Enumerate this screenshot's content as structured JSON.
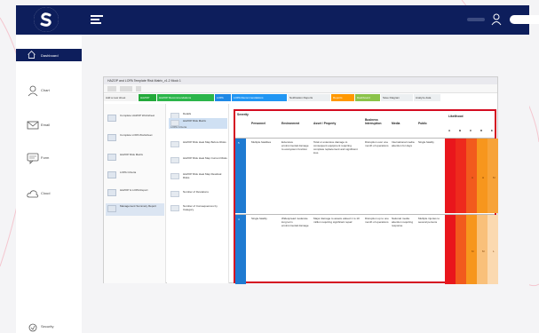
{
  "nav": {
    "items": [
      {
        "label": "Dashboard",
        "icon": "home-icon"
      },
      {
        "label": "Chart",
        "icon": "user-icon"
      },
      {
        "label": "Email",
        "icon": "mail-icon"
      },
      {
        "label": "Form",
        "icon": "chat-icon"
      },
      {
        "label": "Cloud",
        "icon": "cloud-icon"
      },
      {
        "label": "Security",
        "icon": "lock-icon"
      }
    ]
  },
  "shot": {
    "title": "HAZOP and LOPA Template Risk Matrix_v1.2 Mock 1",
    "ribbon": [
      {
        "label": "Add a new sheet",
        "color": "#f3f3f3",
        "text": "#333"
      },
      {
        "label": "HAZOP",
        "color": "#23a93a",
        "text": "#fff"
      },
      {
        "label": "HAZOP Recommendations",
        "color": "#2bb54a",
        "text": "#fff"
      },
      {
        "label": "LOPA",
        "color": "#1e88e5",
        "text": "#fff"
      },
      {
        "label": "LOPA Recommendations",
        "color": "#2196f3",
        "text": "#fff"
      },
      {
        "label": "Notification Reports",
        "color": "#eceff1",
        "text": "#333"
      },
      {
        "label": "Reports",
        "color": "#ff9800",
        "text": "#fff"
      },
      {
        "label": "Dashboard",
        "color": "#8bc34a",
        "text": "#fff"
      },
      {
        "label": "Save Diagram",
        "color": "#eceff1",
        "text": "#333"
      },
      {
        "label": "Analyze data",
        "color": "#eceff1",
        "text": "#333"
      }
    ],
    "files": [
      {
        "label": "Complete HAZOP Worksheet"
      },
      {
        "label": "Complete LOPA Worksheet"
      },
      {
        "label": "HAZOP Risk Matrix"
      },
      {
        "label": "LOPA Criteria"
      },
      {
        "label": "HAZOP & LOPA Report"
      },
      {
        "label": "Management Summary Report"
      }
    ],
    "items_header": "LOPA Criteria",
    "items": [
      {
        "label": "Details"
      },
      {
        "label": "HAZOP Risk Matrix"
      },
      {
        "label": "HAZOP Risk Heat Map Before Risks"
      },
      {
        "label": "HAZOP Risk Heat Map Current Risks"
      },
      {
        "label": "HAZOP Risk Heat Map Residual Risks"
      },
      {
        "label": "Number of Deviations"
      },
      {
        "label": "Number of Consequences by Category"
      }
    ],
    "grid": {
      "headers": [
        "Severity",
        "Personnel",
        "Environment",
        "Asset / Property",
        "Business Interruption",
        "Media",
        "Public",
        "Likelihood"
      ],
      "likelihood_levels": [
        "A",
        "B",
        "C",
        "D",
        "E"
      ],
      "rows": [
        {
          "sev": "5",
          "personnel": "Multiple fatalities",
          "environment": "Extensive environmental damage to ecosystem function",
          "asset": "Total or extensive damage to consequent equipment requiring complete replacement and significant loss",
          "business": "Disruption over one month of operations",
          "media": "International media attention for days",
          "public": "Single fatality",
          "cells": [
            "#e9161c",
            "#ee2a1d",
            "#f25a1d",
            "#f7961d",
            "#f7a33a"
          ],
          "labels": [
            "",
            "",
            "H",
            "H",
            "M"
          ]
        },
        {
          "sev": "4",
          "personnel": "Single fatality",
          "environment": "Widespread moderate long term environmental damage",
          "asset": "Major damage to assets valued 1 to 10 million requiring significant repair",
          "business": "Disruption up to one month of operations",
          "media": "National media attention requiring response",
          "public": "Multiple injuries to several persons",
          "cells": [
            "#e9161c",
            "#f25a1d",
            "#f7961d",
            "#f9c07a",
            "#fbd9b0"
          ],
          "labels": [
            "",
            "",
            "M",
            "M",
            "L"
          ]
        }
      ]
    }
  }
}
